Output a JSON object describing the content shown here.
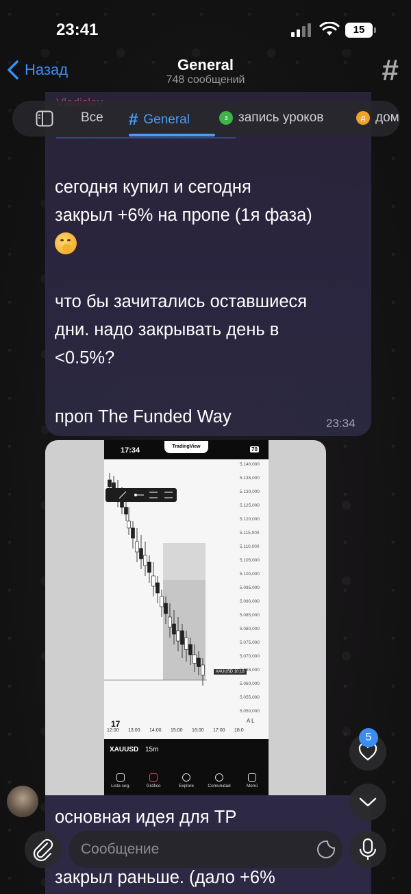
{
  "status": {
    "time": "23:41",
    "battery": "15"
  },
  "nav": {
    "back_label": "Назад",
    "title": "General",
    "subtitle": "748 сообщений"
  },
  "tabs": [
    {
      "label": "Все"
    },
    {
      "label": "General"
    },
    {
      "label": "запись уроков"
    },
    {
      "label": "дом"
    }
  ],
  "message1": {
    "line1": "сегодня купил и сегодня",
    "line2": "закрыл +6% на пропе (1я фаза)",
    "line3": "что бы зачитались оставшиеся",
    "line4": "дни. надо закрывать день в",
    "line5": "<0.5%?",
    "line6": "проп The Funded Way",
    "time": "23:34"
  },
  "screenshot": {
    "time": "17:34",
    "brand": "TradingView",
    "battery": "70",
    "prices": [
      "5.140,000",
      "5.135,000",
      "5.130,000",
      "5.125,000",
      "5.120,000",
      "5.115,000",
      "5.110,000",
      "5.105,000",
      "5.100,000",
      "5.095,000",
      "5.090,000",
      "5.085,000",
      "5.080,000",
      "5.075,000",
      "5.070,000",
      "5.065,000",
      "5.060,000",
      "5.055,000",
      "5.050,000"
    ],
    "times": [
      "12:00",
      "13:00",
      "14:00",
      "15:00",
      "16:00",
      "17:00",
      "18:0"
    ],
    "symbol": "XAUUSD",
    "symbol_short": "XAUUSD",
    "clock": "10:18",
    "timeframe": "15m",
    "nav": [
      "Lista seg.",
      "Gráfico",
      "Explore",
      "Comunidad",
      "Menú"
    ]
  },
  "message2": {
    "line1": "основная идея для ТР",
    "line2": "закрыл раньше. (дало +6%"
  },
  "badge_count": "5",
  "input": {
    "placeholder": "Сообщение"
  },
  "colors": {
    "accent": "#3b8ff6",
    "bubble": "#2b2640",
    "background": "#141414"
  }
}
